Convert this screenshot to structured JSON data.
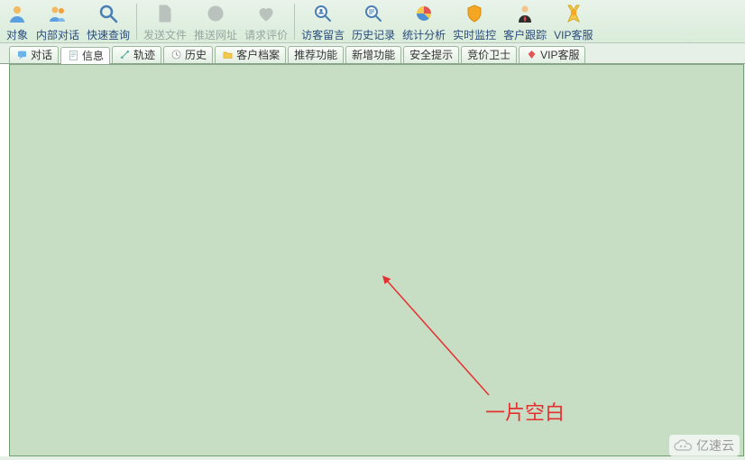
{
  "toolbar": {
    "groups": [
      [
        {
          "name": "object",
          "label": "对象",
          "icon": "person",
          "disabled": false
        },
        {
          "name": "internal-chat",
          "label": "内部对话",
          "icon": "people",
          "disabled": false
        },
        {
          "name": "quick-search",
          "label": "快速查询",
          "icon": "magnifier",
          "disabled": false
        }
      ],
      [
        {
          "name": "send-file",
          "label": "发送文件",
          "icon": "file",
          "disabled": true
        },
        {
          "name": "push-url",
          "label": "推送网址",
          "icon": "globe",
          "disabled": true
        },
        {
          "name": "request-rating",
          "label": "请求评价",
          "icon": "heart",
          "disabled": true
        }
      ],
      [
        {
          "name": "visitor-msg",
          "label": "访客留言",
          "icon": "search-person",
          "disabled": false
        },
        {
          "name": "history",
          "label": "历史记录",
          "icon": "search-doc",
          "disabled": false
        },
        {
          "name": "stats",
          "label": "统计分析",
          "icon": "pie",
          "disabled": false
        },
        {
          "name": "realtime",
          "label": "实时监控",
          "icon": "shield",
          "disabled": false
        },
        {
          "name": "customer-track",
          "label": "客户跟踪",
          "icon": "suit",
          "disabled": false
        },
        {
          "name": "vip-service",
          "label": "VIP客服",
          "icon": "medal",
          "disabled": false
        }
      ]
    ]
  },
  "tabs": [
    {
      "name": "dialog",
      "label": "对话",
      "icon": "chat",
      "active": false
    },
    {
      "name": "info",
      "label": "信息",
      "icon": "doc",
      "active": true
    },
    {
      "name": "trace",
      "label": "轨迹",
      "icon": "path",
      "active": false
    },
    {
      "name": "history",
      "label": "历史",
      "icon": "clock",
      "active": false
    },
    {
      "name": "customer-file",
      "label": "客户档案",
      "icon": "folder",
      "active": false
    },
    {
      "name": "recommend",
      "label": "推荐功能",
      "icon": "",
      "active": false
    },
    {
      "name": "new-feature",
      "label": "新增功能",
      "icon": "",
      "active": false
    },
    {
      "name": "security-tips",
      "label": "安全提示",
      "icon": "",
      "active": false
    },
    {
      "name": "bid-guard",
      "label": "竞价卫士",
      "icon": "",
      "active": false
    },
    {
      "name": "vip-service-tab",
      "label": "VIP客服",
      "icon": "diamond",
      "active": false
    }
  ],
  "annotation": {
    "text": "一片空白"
  },
  "watermark": {
    "text": "亿速云"
  }
}
